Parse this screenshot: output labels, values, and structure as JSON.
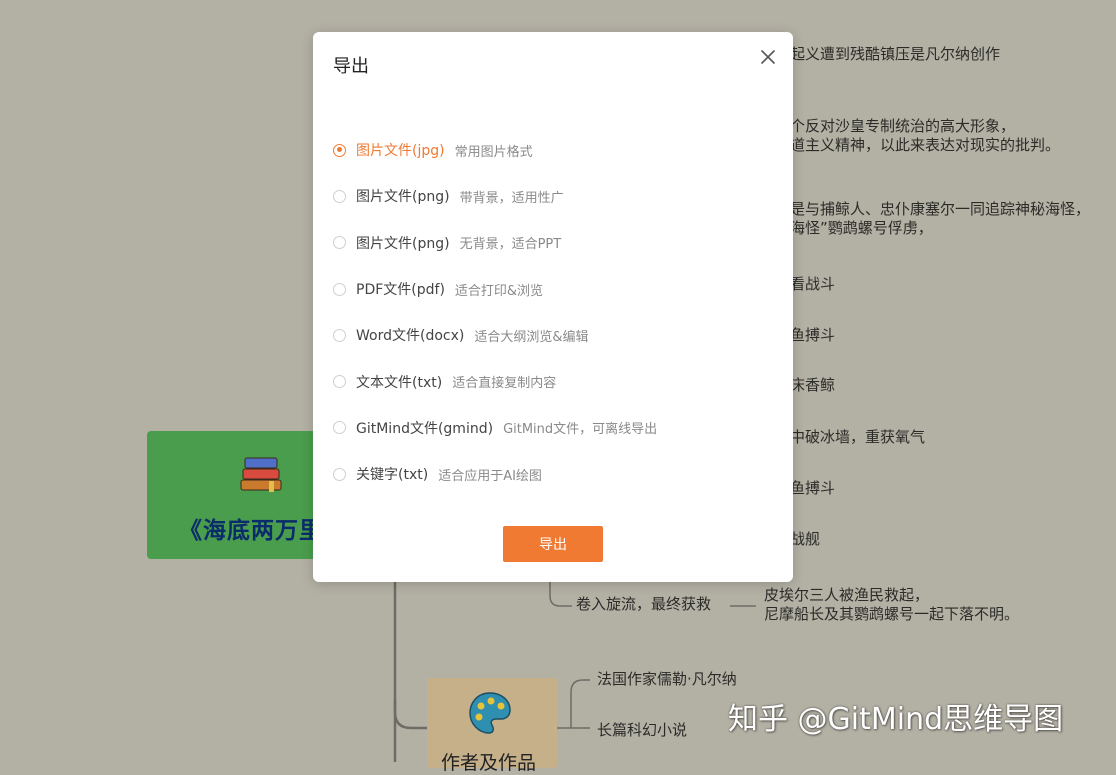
{
  "background": {
    "mindmap_texts": [
      "起义遭到残酷镇压是凡尔纳创作",
      "个反对沙皇专制统治的高大形象，",
      "道主义精神，以此来表达对现实的批判。",
      "是与捕鲸人、忠仆康塞尔一同追踪神秘海怪，",
      "海怪”鹦鹉螺号俘虏，",
      "看战斗",
      "鱼搏斗",
      "床香鲸",
      "中破冰墙，重获氧气",
      "鱼搏斗",
      "战舰"
    ],
    "branch_label": "卷入旋流，最终获救",
    "branch_detail_1": "皮埃尔三人被渔民救起，",
    "branch_detail_2": "尼摩船长及其鹦鹉螺号一起下落不明。",
    "root_title": "《海底两万里",
    "author_title": "作者及作品",
    "author_detail_1": "法国作家儒勒·凡尔纳",
    "author_detail_2": "长篇科幻小说",
    "watermark": "知乎 @GitMind思维导图",
    "root_icon": "books-icon",
    "author_icon": "palette-icon"
  },
  "dialog": {
    "title": "导出",
    "close_icon": "close-icon",
    "options": [
      {
        "name": "图片文件(jpg)",
        "desc": "常用图片格式",
        "selected": true
      },
      {
        "name": "图片文件(png)",
        "desc": "带背景，适用性广",
        "selected": false
      },
      {
        "name": "图片文件(png)",
        "desc": "无背景，适合PPT",
        "selected": false
      },
      {
        "name": "PDF文件(pdf)",
        "desc": "适合打印&浏览",
        "selected": false
      },
      {
        "name": "Word文件(docx)",
        "desc": "适合大纲浏览&编辑",
        "selected": false
      },
      {
        "name": "文本文件(txt)",
        "desc": "适合直接复制内容",
        "selected": false
      },
      {
        "name": "GitMind文件(gmind)",
        "desc": "GitMind文件，可离线导出",
        "selected": false
      },
      {
        "name": "关键字(txt)",
        "desc": "适合应用于AI绘图",
        "selected": false
      }
    ],
    "export_label": "导出"
  },
  "colors": {
    "accent": "#f07a32",
    "overlay_bg": "#b3b0a4",
    "root_node": "#4a9d4c",
    "author_node": "#c6b08a"
  }
}
